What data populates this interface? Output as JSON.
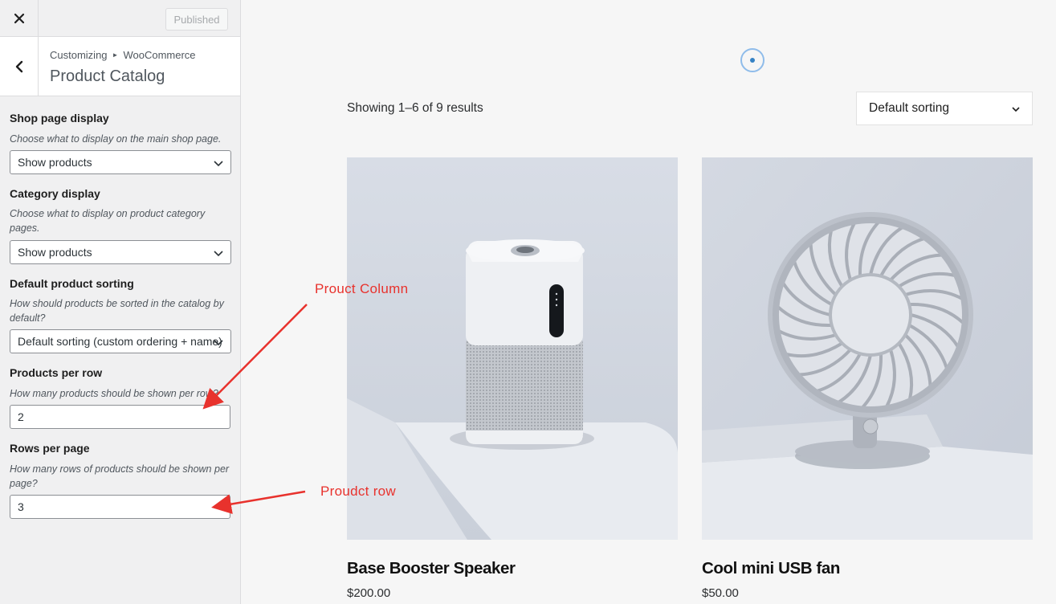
{
  "topbar": {
    "published_label": "Published"
  },
  "section": {
    "breadcrumb_parent": "Customizing",
    "breadcrumb_child": "WooCommerce",
    "title": "Product Catalog"
  },
  "controls": {
    "shop_page_display": {
      "label": "Shop page display",
      "description": "Choose what to display on the main shop page.",
      "value": "Show products"
    },
    "category_display": {
      "label": "Category display",
      "description": "Choose what to display on product category pages.",
      "value": "Show products"
    },
    "default_sorting": {
      "label": "Default product sorting",
      "description": "How should products be sorted in the catalog by default?",
      "value": "Default sorting (custom ordering + name)"
    },
    "products_per_row": {
      "label": "Products per row",
      "description": "How many products should be shown per row?",
      "value": "2"
    },
    "rows_per_page": {
      "label": "Rows per page",
      "description": "How many rows of products should be shown per page?",
      "value": "3"
    }
  },
  "preview": {
    "result_count": "Showing 1–6 of 9 results",
    "sort_value": "Default sorting",
    "products": [
      {
        "name": "Base Booster Speaker",
        "price": "$200.00"
      },
      {
        "name": "Cool mini USB fan",
        "price": "$50.00"
      }
    ]
  },
  "annotations": {
    "column_note": "Prouct Column",
    "row_note": "Proudct row"
  },
  "colors": {
    "annotation": "#e8322d",
    "spinner": "#3582c4",
    "product_bg": "#d2d8e2"
  },
  "icons": [
    "close-icon",
    "back-chevron-icon",
    "chevron-down-icon",
    "loading-spinner-icon"
  ]
}
